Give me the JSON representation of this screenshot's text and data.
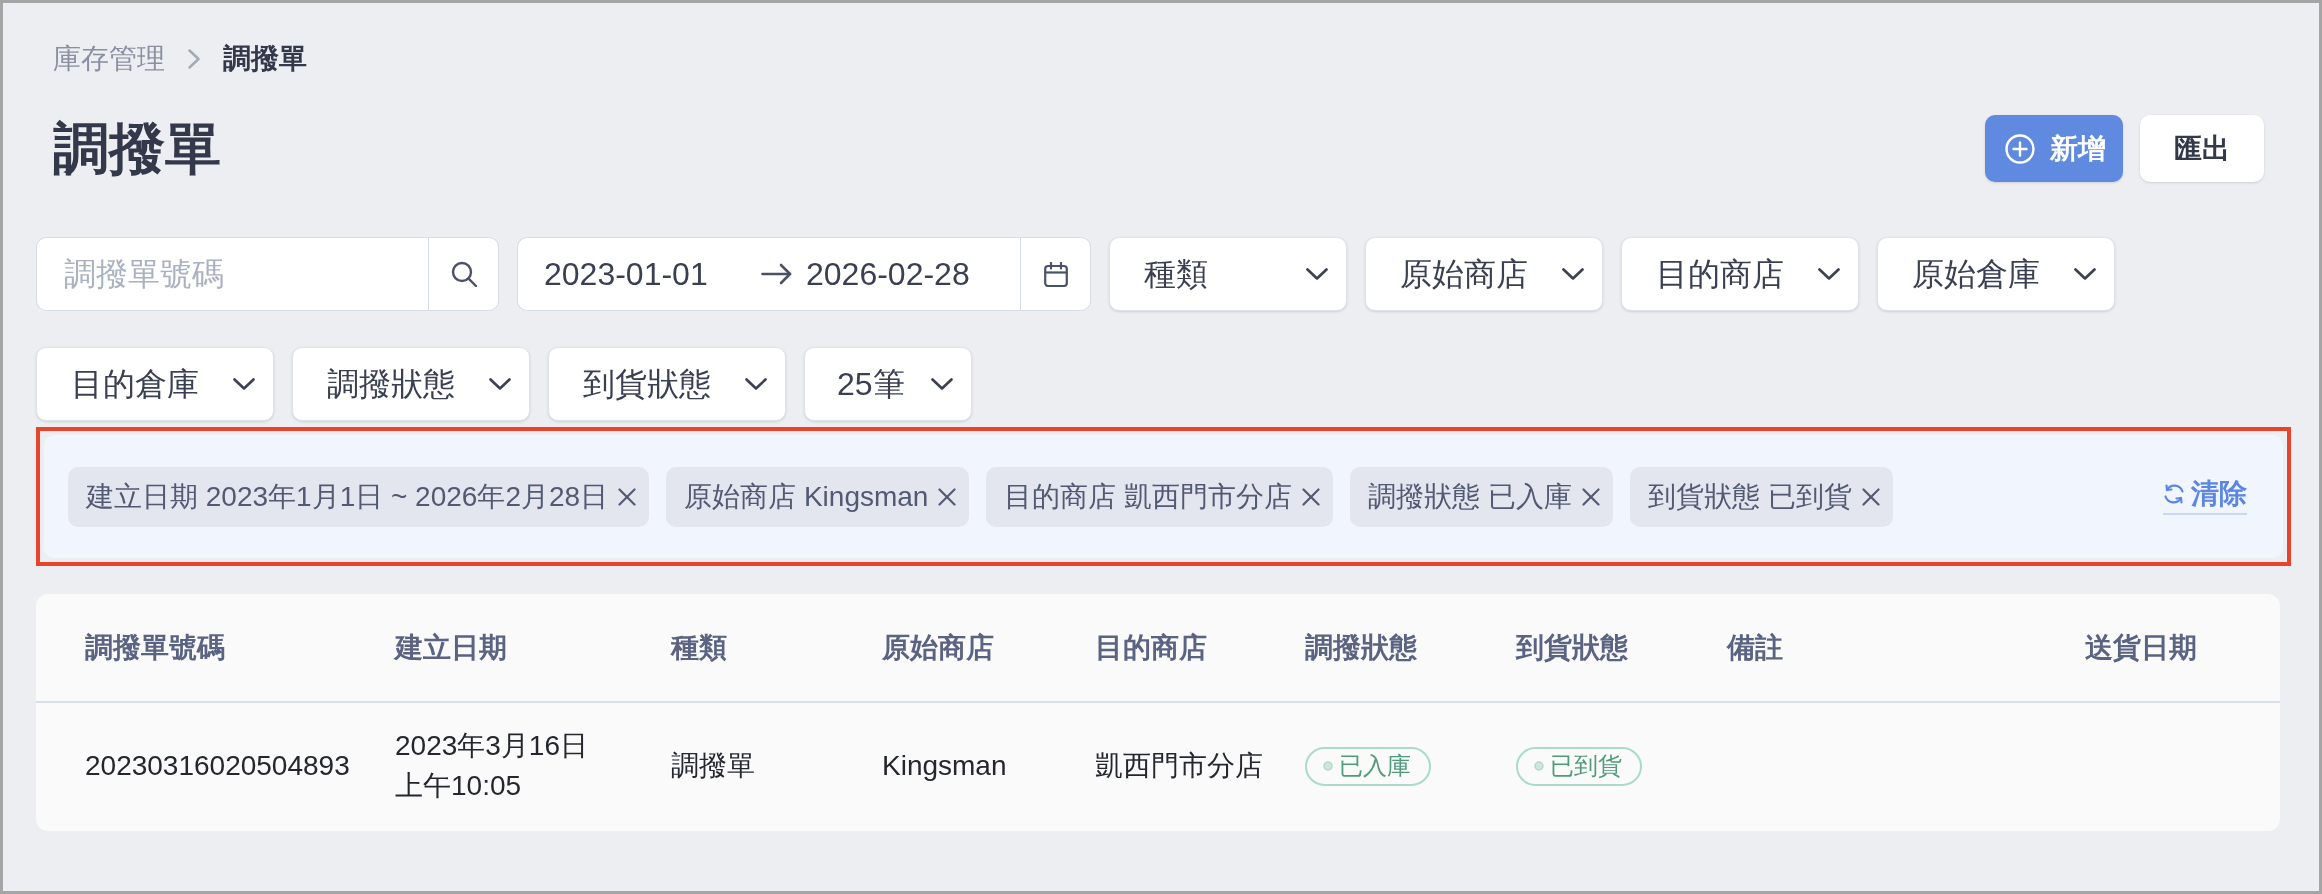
{
  "breadcrumb": [
    {
      "label": "庫存管理",
      "current": false
    },
    {
      "label": "調撥單",
      "current": true
    }
  ],
  "page_title": "調撥單",
  "actions": [
    {
      "kind": "primary",
      "label": "新增"
    },
    {
      "kind": "secondary",
      "label": "匯出"
    }
  ],
  "filters": [
    {
      "kind": "search",
      "placeholder": "調撥單號碼"
    },
    {
      "kind": "date_range",
      "start": "2023-01-01",
      "end": "2026-02-28"
    },
    {
      "kind": "dropdown",
      "label": "種類"
    },
    {
      "kind": "dropdown",
      "label": "原始商店"
    },
    {
      "kind": "dropdown",
      "label": "目的商店"
    },
    {
      "kind": "dropdown",
      "label": "原始倉庫"
    },
    {
      "kind": "dropdown",
      "label": "目的倉庫"
    },
    {
      "kind": "dropdown",
      "label": "調撥狀態"
    },
    {
      "kind": "dropdown",
      "label": "到貨狀態"
    },
    {
      "kind": "page_size",
      "label": "25筆"
    }
  ],
  "active_filters": {
    "chips": [
      {
        "text": "建立日期 2023年1月1日 ~ 2026年2月28日"
      },
      {
        "text": "原始商店 Kingsman"
      },
      {
        "text": "目的商店 凱西門市分店"
      },
      {
        "text": "調撥狀態 已入庫"
      },
      {
        "text": "到貨狀態 已到貨"
      }
    ],
    "clear_label": "清除"
  },
  "table": {
    "columns": [
      "調撥單號碼",
      "建立日期",
      "種類",
      "原始商店",
      "目的商店",
      "調撥狀態",
      "到貨狀態",
      "備註",
      "送貨日期"
    ],
    "rows": [
      {
        "cells": [
          {
            "kind": "text",
            "text": "20230316020504893"
          },
          {
            "kind": "text",
            "text": "2023年3月16日上午10:05"
          },
          {
            "kind": "text",
            "text": "調撥單"
          },
          {
            "kind": "text",
            "text": "Kingsman"
          },
          {
            "kind": "text",
            "text": "凱西門市分店"
          },
          {
            "kind": "badge",
            "text": "已入庫"
          },
          {
            "kind": "badge",
            "text": "已到貨"
          }
        ]
      }
    ]
  }
}
